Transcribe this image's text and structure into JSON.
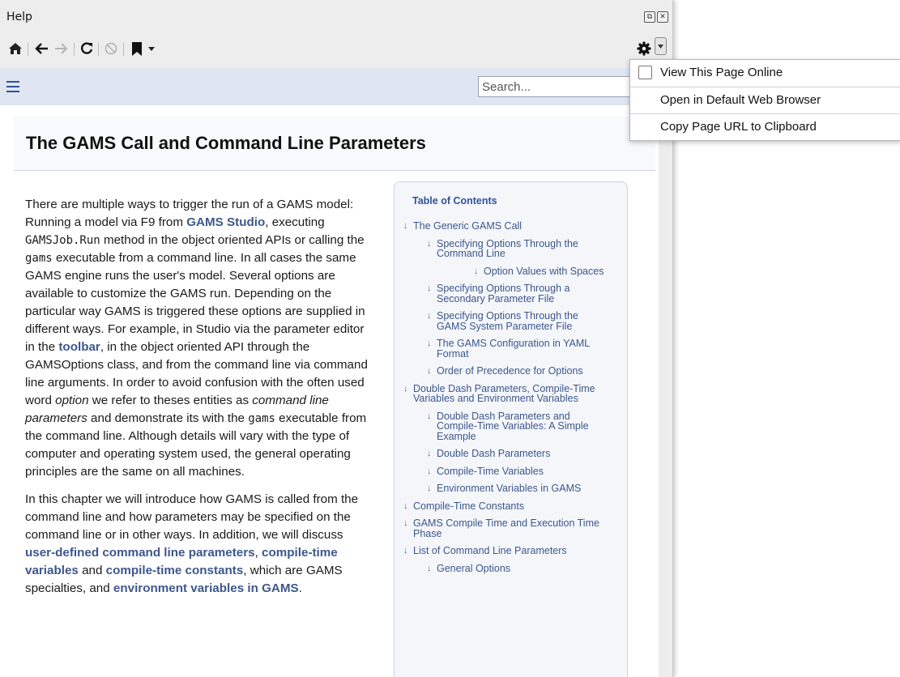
{
  "window": {
    "title": "Help"
  },
  "toolbar": {
    "icons": [
      "home-icon",
      "back-icon",
      "forward-icon",
      "reload-icon",
      "stop-icon",
      "bookmark-icon",
      "chevron-down-icon",
      "gear-icon"
    ]
  },
  "search": {
    "placeholder": "Search..."
  },
  "page": {
    "title": "The GAMS Call and Command Line Parameters"
  },
  "article": {
    "p1": {
      "t1": "There are multiple ways to trigger the run of a GAMS model: Running a model via F9 from ",
      "link_studio": "GAMS Studio",
      "t2": ", executing ",
      "code1": "GAMSJob.Run",
      "t3": " method in the object oriented APIs or calling the ",
      "code2": "gams",
      "t4": " executable from a command line. In all cases the same GAMS engine runs the user's model. Several options are available to customize the GAMS run. Depending on the particular way GAMS is triggered these options are supplied in different ways. For example, in Studio via the parameter editor in the ",
      "link_toolbar": "toolbar",
      "t5": ", in the object oriented API through the GAMSOptions class, and from the command line via command line arguments. In order to avoid confusion with the often used word ",
      "em1": "option",
      "t6": " we refer to theses entities as ",
      "em2": "command line parameters",
      "t7": " and demonstrate its with the ",
      "code3": "gams",
      "t8": " executable from the command line. Although details will vary with the type of computer and operating system used, the general operating principles are the same on all machines."
    },
    "p2": {
      "t1": "In this chapter we will introduce how GAMS is called from the command line and how parameters may be specified on the command line or in other ways. In addition, we will discuss ",
      "link1": "user-defined command line parameters",
      "t2": ", ",
      "link2": "compile-time variables",
      "t3": " and ",
      "link3": "compile-time constants",
      "t4": ", which are GAMS specialties, and ",
      "link4": "environment variables in GAMS",
      "t5": "."
    }
  },
  "toc": {
    "heading": "Table of Contents",
    "items": [
      {
        "label": "The Generic GAMS Call",
        "level": 1
      },
      {
        "label": "Specifying Options Through the Command Line",
        "level": 2
      },
      {
        "label": "Option Values with Spaces",
        "level": 3
      },
      {
        "label": "Specifying Options Through a Secondary Parameter File",
        "level": 2
      },
      {
        "label": "Specifying Options Through the GAMS System Parameter File",
        "level": 2
      },
      {
        "label": "The GAMS Configuration in YAML Format",
        "level": 2
      },
      {
        "label": "Order of Precedence for Options",
        "level": 2
      },
      {
        "label": "Double Dash Parameters, Compile-Time Variables and Environment Variables",
        "level": 1
      },
      {
        "label": "Double Dash Parameters and Compile-Time Variables: A Simple Example",
        "level": 2
      },
      {
        "label": "Double Dash Parameters",
        "level": 2
      },
      {
        "label": "Compile-Time Variables",
        "level": 2
      },
      {
        "label": "Environment Variables in GAMS",
        "level": 2
      },
      {
        "label": "Compile-Time Constants",
        "level": 1
      },
      {
        "label": "GAMS Compile Time and Execution Time Phase",
        "level": 1
      },
      {
        "label": "List of Command Line Parameters",
        "level": 1
      },
      {
        "label": "General Options",
        "level": 2
      }
    ]
  },
  "menu": {
    "items": [
      {
        "label": "View This Page Online",
        "checkable": true,
        "checked": false
      },
      {
        "label": "Open in Default Web Browser"
      },
      {
        "label": "Copy Page URL to Clipboard"
      }
    ]
  }
}
